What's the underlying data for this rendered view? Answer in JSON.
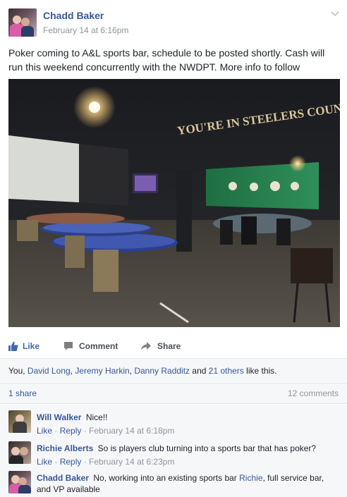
{
  "post": {
    "author": "Chadd Baker",
    "timestamp": "February 14 at 6:16pm",
    "text": "Poker coming to A&L sports bar, schedule to be posted shortly. Cash will run this weekend concurrently with the NWDPT. More info to follow",
    "photo_sign": "YOU'RE IN STEELERS COUNTRY"
  },
  "actions": {
    "like": "Like",
    "comment": "Comment",
    "share": "Share"
  },
  "likes": {
    "prefix": "You, ",
    "names": [
      "David Long",
      "Jeremy Harkin",
      "Danny Radditz"
    ],
    "sep1": ", ",
    "sep2": ", ",
    "and": " and ",
    "others": "21 others",
    "suffix": " like this."
  },
  "shares": {
    "count_label": "1 share",
    "comments_label": "12 comments"
  },
  "comments": [
    {
      "author": "Will Walker",
      "text": "Nice!!",
      "like": "Like",
      "reply": "Reply",
      "time": "February 14 at 6:18pm"
    },
    {
      "author": "Richie Alberts",
      "text": "So is players club turning into a sports bar that has poker?",
      "like": "Like",
      "reply": "Reply",
      "time": "February 14 at 6:23pm"
    },
    {
      "author": "Chadd Baker",
      "text_before": "No, working into an existing sports bar ",
      "mention": "Richie",
      "text_after": ", full service bar, and VP available"
    }
  ],
  "colors": {
    "link": "#365899",
    "meta": "#90949c",
    "like_blue": "#4267b2",
    "panel_bg": "#f6f7f9"
  }
}
